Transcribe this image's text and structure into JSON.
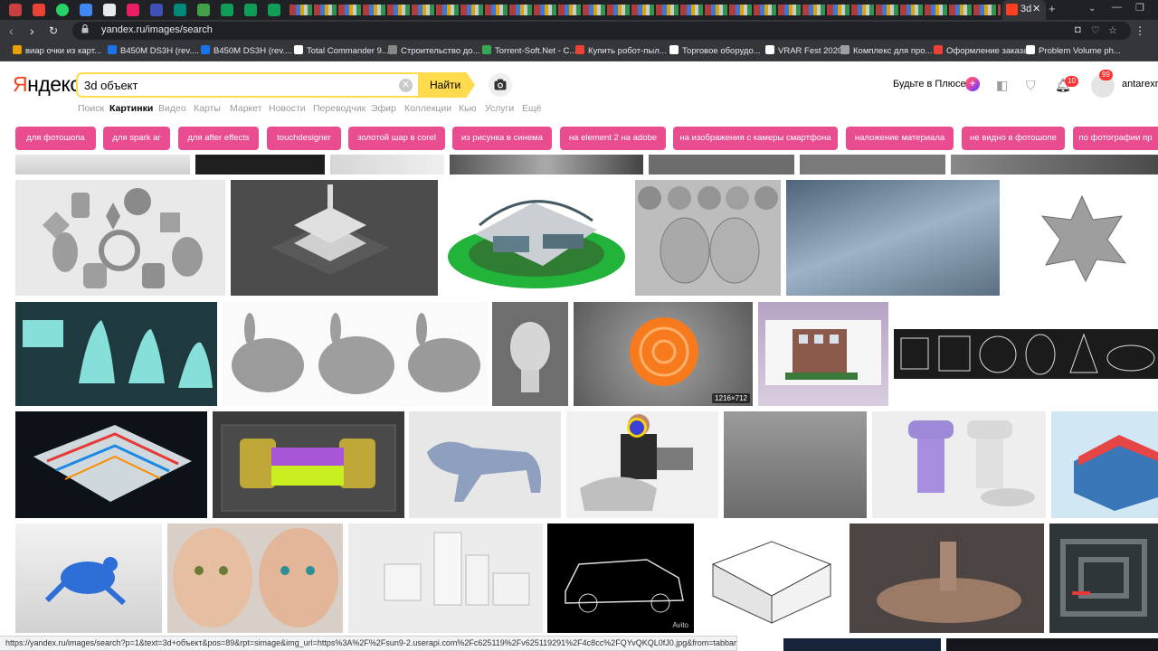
{
  "browser": {
    "active_tab_title": "3d",
    "new_tab_label": "+",
    "url": "yandex.ru/images/search",
    "bookmarks": [
      {
        "label": "виар очки из карт...",
        "color": "#e8a000"
      },
      {
        "label": "B450M DS3H (rev....",
        "color": "#1a73e8"
      },
      {
        "label": "B450M DS3H (rev....",
        "color": "#1a73e8"
      },
      {
        "label": "Total Commander 9...",
        "color": "#ffffff"
      },
      {
        "label": "Строительство до...",
        "color": "#888888"
      },
      {
        "label": "Torrent-Soft.Net - C...",
        "color": "#34a853"
      },
      {
        "label": "Купить робот-пыл...",
        "color": "#ea4335"
      },
      {
        "label": "Торговое оборудо...",
        "color": "#ffffff"
      },
      {
        "label": "VRAR Fest 2020",
        "color": "#ffffff"
      },
      {
        "label": "Комплекс для про...",
        "color": "#9aa0a6"
      },
      {
        "label": "Оформление заказа",
        "color": "#ea4335"
      },
      {
        "label": "Problem Volume ph...",
        "color": "#ffffff"
      }
    ],
    "status_url": "https://yandex.ru/images/search?p=1&text=3d+объект&pos=89&rpt=simage&img_url=https%3A%2F%2Fsun9-2.userapi.com%2Fc625119%2Fv625119291%2F4c8cc%2FQYvQKQL0fJ0.jpg&from=tabbar"
  },
  "header": {
    "logo_first": "Я",
    "logo_rest": "ндекс",
    "search_value": "3d объект",
    "find_label": "Найти",
    "plus_label": "Будьте в Плюсе",
    "notification_count": "10",
    "mail_count": "99",
    "user_name": "antarexru"
  },
  "services": [
    {
      "label": "Поиск",
      "active": false
    },
    {
      "label": "Картинки",
      "active": true
    },
    {
      "label": "Видео",
      "active": false
    },
    {
      "label": "Карты",
      "active": false
    },
    {
      "label": "Маркет",
      "active": false
    },
    {
      "label": "Новости",
      "active": false
    },
    {
      "label": "Переводчик",
      "active": false
    },
    {
      "label": "Эфир",
      "active": false
    },
    {
      "label": "Коллекции",
      "active": false
    },
    {
      "label": "Кью",
      "active": false
    },
    {
      "label": "Услуги",
      "active": false
    },
    {
      "label": "Ещё",
      "active": false
    }
  ],
  "chips": [
    "для фотошопа",
    "для spark ar",
    "для after effects",
    "touchdesigner",
    "золотой шар в corel",
    "из рисунка в синема",
    "на element 2 на adobe",
    "на изображения с камеры смартфона",
    "наложение материала",
    "не видно в фотошопе",
    "по фотографии пр"
  ],
  "images": {
    "polyhedron_size": "1216×712",
    "car_watermark": "Avito"
  },
  "colors": {
    "accent_yellow": "#ffdb4d",
    "chip_pink": "#ea4d8f",
    "yandex_red": "#fc3f1d"
  }
}
